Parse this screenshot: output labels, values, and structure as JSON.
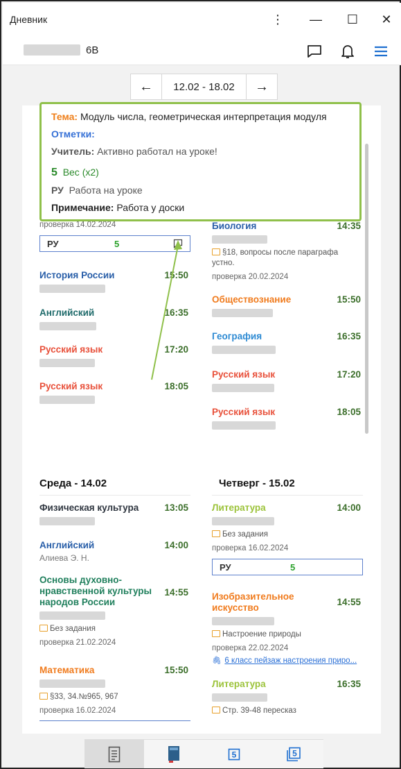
{
  "window": {
    "title": "Дневник",
    "menu_glyph": "⋮",
    "min_glyph": "—",
    "max_glyph": "☐",
    "close_glyph": "✕"
  },
  "appbar": {
    "class_label": "6В",
    "icons": [
      "chat-icon",
      "bell-icon",
      "menu-icon"
    ]
  },
  "week": {
    "prev": "←",
    "range": "12.02 - 18.02",
    "next": "→"
  },
  "popup": {
    "topic_label": "Тема:",
    "topic_value": "Модуль числа, геометрическая интерпретация модуля",
    "marks_label": "Отметки:",
    "teacher_label": "Учитель:",
    "teacher_value": "Активно работал на уроке!",
    "grade": "5",
    "weight": "Вес (x2)",
    "type_code": "РУ",
    "type_value": "Работа на уроке",
    "note_label": "Примечание:",
    "note_value": "Работа у доски"
  },
  "monday_tail": {
    "check": "проверка 14.02.2024",
    "grade_code": "РУ",
    "grade": "5"
  },
  "left_lessons": [
    {
      "subject": "История России",
      "time": "15:50",
      "teacher": "",
      "color": "c-blue"
    },
    {
      "subject": "Английский",
      "time": "16:35",
      "teacher": "",
      "color": "c-teal"
    },
    {
      "subject": "Русский язык",
      "time": "17:20",
      "teacher": "",
      "color": "c-red"
    },
    {
      "subject": "Русский язык",
      "time": "18:05",
      "teacher": "",
      "color": "c-red"
    }
  ],
  "tuesday": {
    "bio": {
      "subject": "Биология",
      "time": "14:35",
      "hw": "§18, вопросы после параграфа устно.",
      "check": "проверка 20.02.2024"
    },
    "lessons": [
      {
        "subject": "Обществознание",
        "time": "15:50",
        "color": "c-orange"
      },
      {
        "subject": "География",
        "time": "16:35",
        "color": "c-sky"
      },
      {
        "subject": "Русский язык",
        "time": "17:20",
        "color": "c-red"
      },
      {
        "subject": "Русский язык",
        "time": "18:05",
        "color": "c-red"
      }
    ]
  },
  "wednesday": {
    "title": "Среда - 14.02",
    "l1": {
      "subject": "Физическая культура",
      "time": "13:05"
    },
    "l2": {
      "subject": "Английский",
      "time": "14:00",
      "teacher": "Алиева Э. Н."
    },
    "l3": {
      "subject": "Основы духовно-нравственной культуры народов России",
      "time": "14:55",
      "hw": "Без задания",
      "check": "проверка 21.02.2024"
    },
    "l4": {
      "subject": "Математика",
      "time": "15:50",
      "hw": "§33, 34.№965, 967",
      "check": "проверка 16.02.2024"
    }
  },
  "thursday": {
    "title": "Четверг - 15.02",
    "l1": {
      "subject": "Литература",
      "time": "14:00",
      "hw": "Без задания",
      "check": "проверка 16.02.2024",
      "grade_code": "РУ",
      "grade": "5"
    },
    "l2": {
      "subject": "Изобразительное искусство",
      "time": "14:55",
      "hw": "Настроение природы",
      "check": "проверка 22.02.2024",
      "link": "6 класс пейзаж настроения приро..."
    },
    "l3": {
      "subject": "Литература",
      "time": "16:35",
      "hw": "Стр. 39-48 пересказ"
    }
  },
  "bottom_tabs": [
    "diary-icon",
    "book-icon",
    "grade5-icon",
    "grade5-framed-icon"
  ],
  "colors": {
    "accent_green": "#8fc04a",
    "mark_green": "#2aa12a",
    "link_blue": "#2a6fd6"
  }
}
